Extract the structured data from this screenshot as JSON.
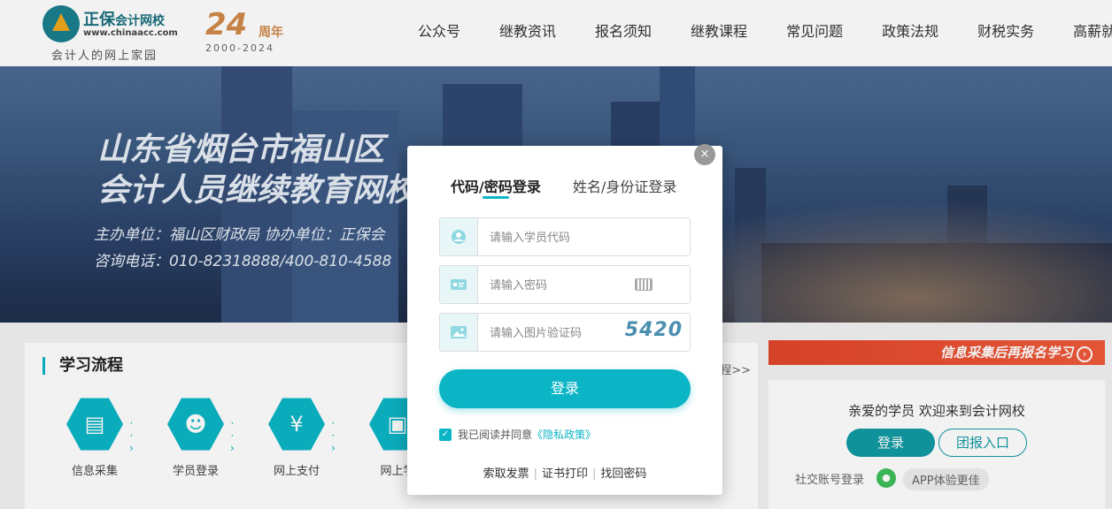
{
  "header": {
    "brand": "正保",
    "brand_sub": "会计网校",
    "url": "www.chinaacc.com",
    "slogan": "会计人的网上家园",
    "anniversary_num": "24",
    "anniversary_suffix": "周年",
    "anniversary_years": "2000-2024",
    "nav": [
      "公众号",
      "继教资讯",
      "报名须知",
      "继教课程",
      "常见问题",
      "政策法规",
      "财税实务",
      "高薪就业"
    ]
  },
  "banner": {
    "title_line1": "山东省烟台市福山区",
    "title_line2": "会计人员继续教育网校",
    "sub_line1": "主办单位：福山区财政局   协办单位：正保会",
    "sub_line2": "咨询电话：010-82318888/400-810-4588"
  },
  "flow": {
    "title": "学习流程",
    "more": "程>>",
    "steps": [
      {
        "label": "信息采集",
        "icon": "clipboard-icon"
      },
      {
        "label": "学员登录",
        "icon": "user-check-icon"
      },
      {
        "label": "网上支付",
        "icon": "money-bag-icon"
      },
      {
        "label": "网上学",
        "icon": "id-card-icon"
      }
    ]
  },
  "right": {
    "promo": "信息采集后再报名学习",
    "welcome": "亲爱的学员 欢迎来到会计网校",
    "login": "登录",
    "group": "团报入口",
    "social_label": "社交账号登录",
    "app_pill": "APP体验更佳"
  },
  "modal": {
    "tab_active": "代码/密码登录",
    "tab_other": "姓名/身份证登录",
    "fields": {
      "code_placeholder": "请输入学员代码",
      "password_placeholder": "请输入密码",
      "captcha_placeholder": "请输入图片验证码",
      "captcha_text": "5420"
    },
    "login_button": "登录",
    "agree_text": "我已阅读并同意",
    "privacy_link": "《隐私政策》",
    "links": [
      "索取发票",
      "证书打印",
      "找回密码"
    ],
    "close": "×"
  },
  "colors": {
    "accent": "#0bb5c6",
    "accent_dark": "#109aa3",
    "promo": "#e0462a"
  }
}
